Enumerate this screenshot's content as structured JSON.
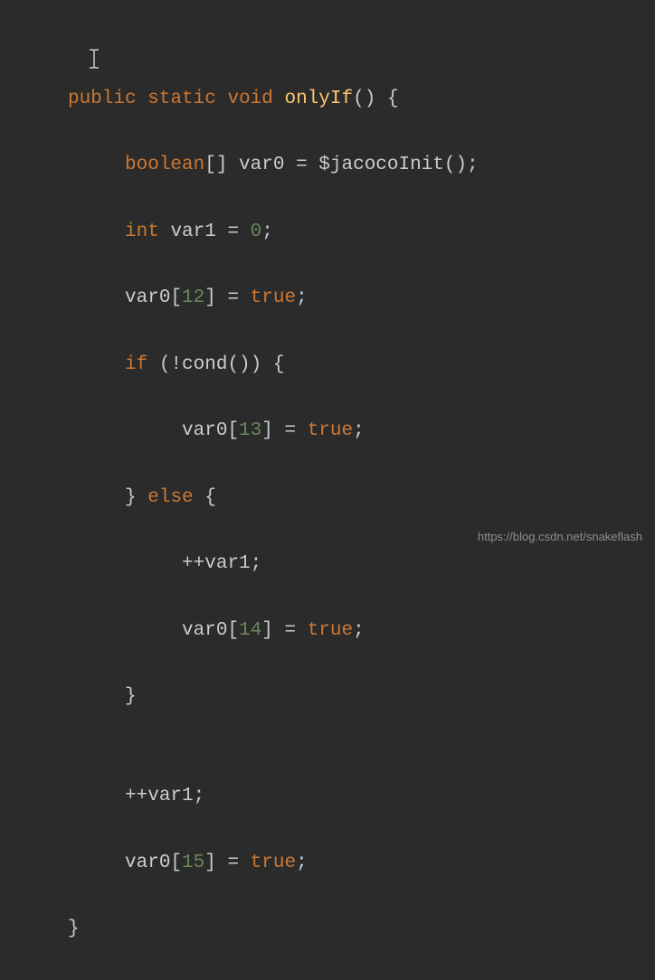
{
  "code": {
    "line1": {
      "public": "public",
      "static": "static",
      "void": "void",
      "method": "onlyIf",
      "parens": "()",
      "brace": " {"
    },
    "line2": {
      "indent": "     ",
      "boolean": "boolean",
      "brackets": "[] ",
      "var": "var0 ",
      "eq": "= ",
      "call": "$jacocoInit();"
    },
    "line3": {
      "indent": "     ",
      "int": "int",
      "sp": " ",
      "var": "var1 ",
      "eq": "= ",
      "zero": "0",
      "semi": ";"
    },
    "line4": {
      "indent": "     ",
      "var": "var0[",
      "idx": "12",
      "close": "] = ",
      "true": "true",
      "semi": ";"
    },
    "line5": {
      "indent": "     ",
      "if": "if",
      "cond": " (!cond()) {"
    },
    "line6": {
      "indent": "          ",
      "var": "var0[",
      "idx": "13",
      "close": "] = ",
      "true": "true",
      "semi": ";"
    },
    "line7": {
      "indent": "     ",
      "close": "} ",
      "else": "else",
      "brace": " {"
    },
    "line8": {
      "indent": "          ",
      "inc": "++var1;"
    },
    "line9": {
      "indent": "          ",
      "var": "var0[",
      "idx": "14",
      "close": "] = ",
      "true": "true",
      "semi": ";"
    },
    "line10": {
      "indent": "     ",
      "close": "}"
    },
    "line11": {
      "blank": ""
    },
    "line12": {
      "indent": "     ",
      "inc": "++var1;"
    },
    "line13": {
      "indent": "     ",
      "var": "var0[",
      "idx": "15",
      "close": "] = ",
      "true": "true",
      "semi": ";"
    },
    "line14": {
      "close": "}"
    }
  },
  "watermark": "https://blog.csdn.net/snakeflash"
}
